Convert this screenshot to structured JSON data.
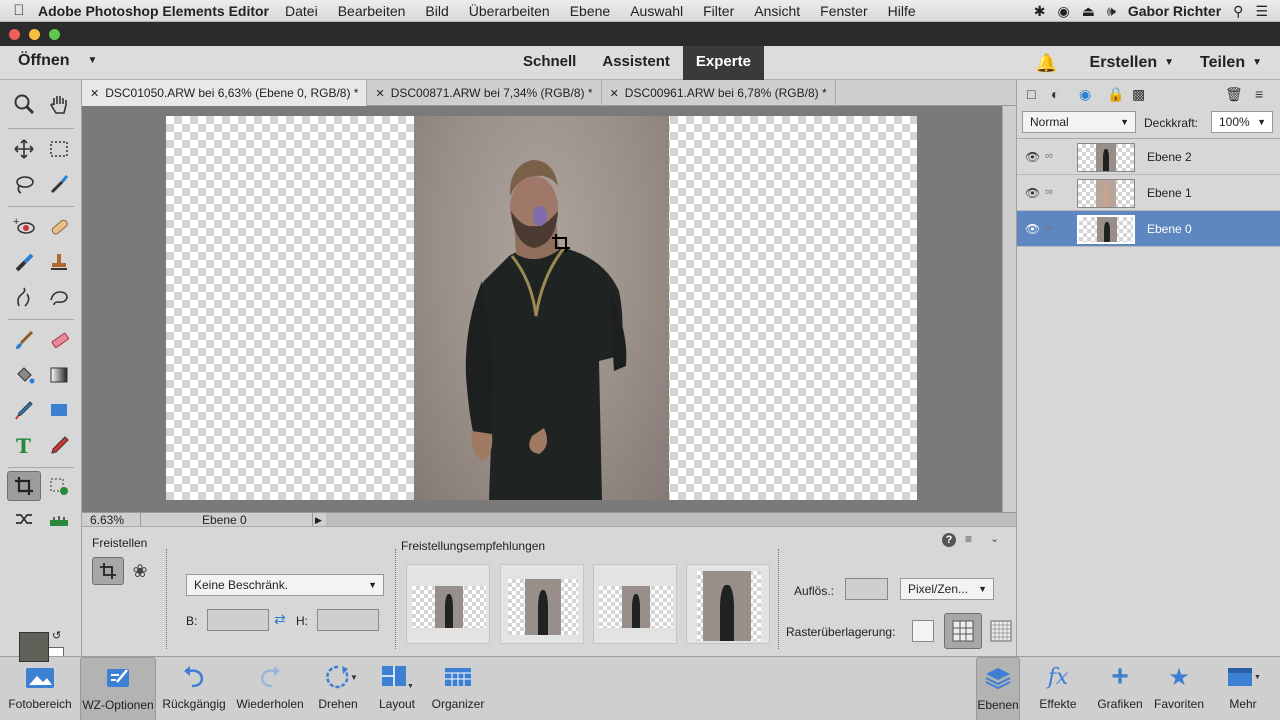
{
  "menubar": {
    "app_name": "Adobe Photoshop Elements Editor",
    "items": [
      "Datei",
      "Bearbeiten",
      "Bild",
      "Überarbeiten",
      "Ebene",
      "Auswahl",
      "Filter",
      "Ansicht",
      "Fenster",
      "Hilfe"
    ],
    "user": "Gabor Richter"
  },
  "header": {
    "open_label": "Öffnen",
    "modes": [
      "Schnell",
      "Assistent",
      "Experte"
    ],
    "active_mode": "Experte",
    "create_label": "Erstellen",
    "share_label": "Teilen"
  },
  "tabs": [
    {
      "label": "DSC01050.ARW bei 6,63% (Ebene 0, RGB/8) *",
      "active": true
    },
    {
      "label": "DSC00871.ARW bei 7,34% (RGB/8) *",
      "active": false
    },
    {
      "label": "DSC00961.ARW bei 6,78% (RGB/8) *",
      "active": false
    }
  ],
  "status": {
    "zoom": "6.63%",
    "layer": "Ebene 0"
  },
  "colors": {
    "foreground": "#5e6259",
    "background": "#ffffff",
    "selected_layer": "#5e86c0",
    "bell": "#2a7fd4"
  },
  "layers_panel": {
    "blend_mode": "Normal",
    "opacity_label": "Deckkraft:",
    "opacity_value": "100%",
    "layers": [
      {
        "name": "Ebene 2",
        "selected": false
      },
      {
        "name": "Ebene 1",
        "selected": false
      },
      {
        "name": "Ebene 0",
        "selected": true
      }
    ]
  },
  "tool_options": {
    "tool_name": "Freistellen",
    "constraint": "Keine Beschränk.",
    "width_label": "B:",
    "height_label": "H:",
    "suggestions_label": "Freistellungsempfehlungen",
    "resolution_label": "Auflös.:",
    "unit": "Pixel/Zen...",
    "grid_label": "Rasterüberlagerung:"
  },
  "bottombar": {
    "items": [
      "Fotobereich",
      "WZ-Optionen",
      "Rückgängig",
      "Wiederholen",
      "Drehen",
      "Layout",
      "Organizer"
    ],
    "right_items": [
      "Ebenen",
      "Effekte",
      "Grafiken",
      "Favoriten",
      "Mehr"
    ]
  }
}
